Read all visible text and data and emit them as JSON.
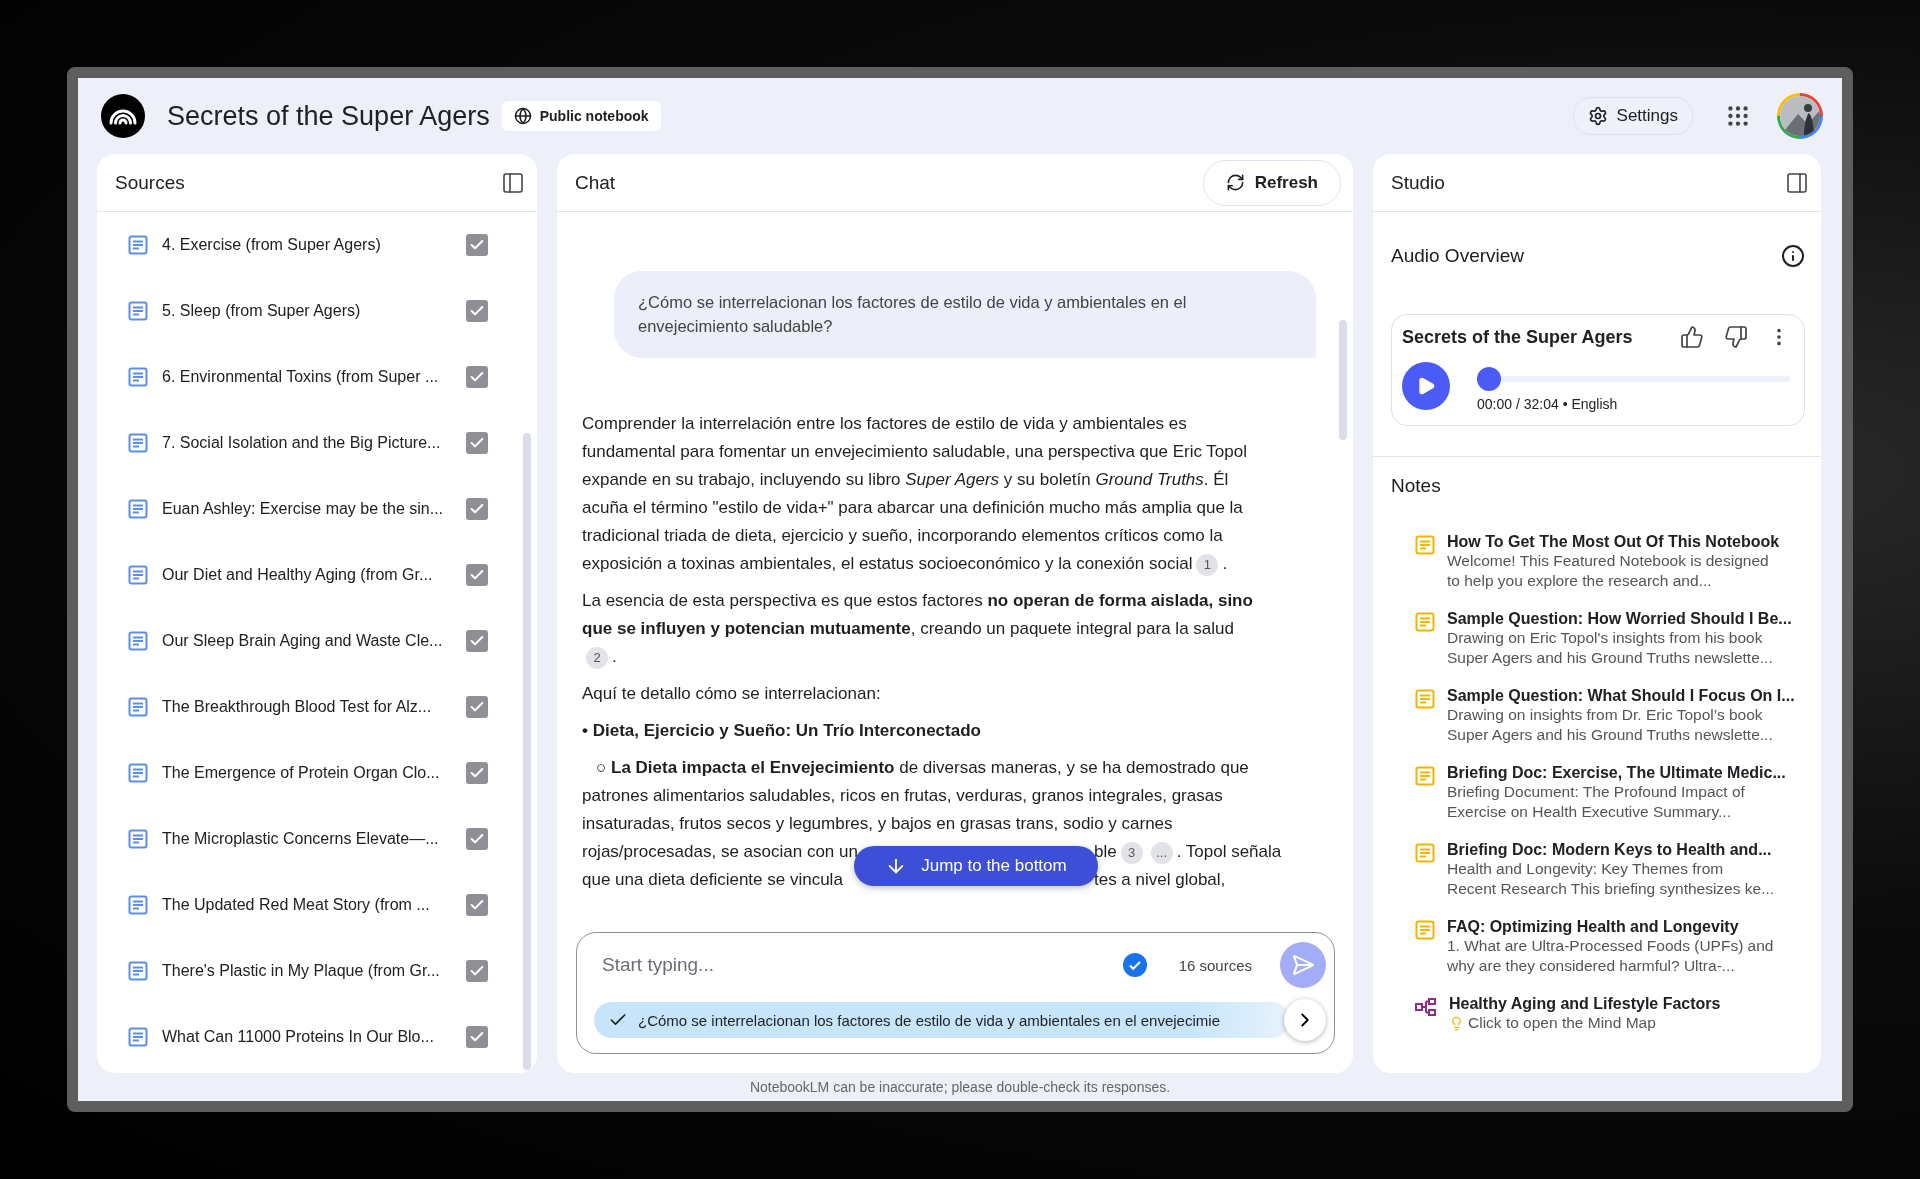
{
  "header": {
    "title": "Secrets of the Super Agers",
    "badge": "Public notebook",
    "settings": "Settings"
  },
  "sources": {
    "title": "Sources",
    "items": [
      {
        "label": "4. Exercise (from Super Agers)",
        "checked": true
      },
      {
        "label": "5. Sleep (from Super Agers)",
        "checked": true
      },
      {
        "label": "6. Environmental Toxins (from Super ...",
        "checked": true
      },
      {
        "label": "7. Social Isolation and the Big Picture...",
        "checked": true
      },
      {
        "label": "Euan Ashley: Exercise may be the sin...",
        "checked": true
      },
      {
        "label": "Our Diet and Healthy Aging (from Gr...",
        "checked": true
      },
      {
        "label": "Our Sleep Brain Aging and Waste Cle...",
        "checked": true
      },
      {
        "label": "The Breakthrough Blood Test for Alz...",
        "checked": true
      },
      {
        "label": "The Emergence of Protein Organ Clo...",
        "checked": true
      },
      {
        "label": "The Microplastic Concerns Elevate—...",
        "checked": true
      },
      {
        "label": "The Updated Red Meat Story (from ...",
        "checked": true
      },
      {
        "label": "There's Plastic in My Plaque (from Gr...",
        "checked": true
      },
      {
        "label": "What Can 11000 Proteins In Our Blo...",
        "checked": true
      }
    ]
  },
  "chat": {
    "title": "Chat",
    "refresh": "Refresh",
    "question": "¿Cómo se interrelacionan los factores de estilo de vida y ambientales en el envejecimiento saludable?",
    "answer": [
      {
        "kind": "paragraph",
        "parts": [
          {
            "kind": "text",
            "text": "Comprender la interrelación entre los factores de estilo de vida y ambientales es fundamental para fomentar un envejecimiento saludable, una perspectiva que Eric Topol expande en su trabajo, incluyendo su libro *Super Agers* y su boletín *Ground Truths*. Él acuña el término \"estilo de vida+\" para abarcar una definición mucho más amplia que la tradicional triada de dieta, ejercicio y sueño, incorporando elementos críticos como la exposición a toxinas ambientales, el estatus socioeconómico y la conexión social"
          },
          {
            "kind": "cite",
            "text": "1"
          },
          {
            "kind": "text",
            "text": "."
          }
        ]
      },
      {
        "kind": "paragraph",
        "parts": [
          {
            "kind": "text",
            "text": "La esencia de esta perspectiva es que estos factores **no operan de forma aislada, sino que se influyen y potencian mutuamente**, creando un paquete integral para la salud"
          },
          {
            "kind": "cite",
            "text": "2"
          },
          {
            "kind": "text",
            "text": "."
          }
        ]
      },
      {
        "kind": "paragraph",
        "parts": [
          {
            "kind": "text",
            "text": "Aquí te detallo cómo se interrelacionan:"
          }
        ]
      },
      {
        "kind": "heading",
        "parts": [
          {
            "kind": "text",
            "text": "• Dieta, Ejercicio y Sueño: Un Trío Interconectado"
          }
        ]
      },
      {
        "kind": "subitem",
        "parts": [
          {
            "kind": "text",
            "text": "○ **La Dieta impacta el Envejecimiento** de diversas maneras, y se ha demostrado que patrones alimentarios saludables, ricos en frutas, verduras, granos integrales, grasas insaturadas, frutos secos y legumbres, y bajos en grasas trans, sodio y carnes"
          }
        ]
      },
      {
        "kind": "covered",
        "overlay": "Jump to the bottom",
        "lines": [
          {
            "left": "rojas/procesadas, se asocian con un",
            "right": [
              {
                "kind": "text",
                "text": "ble"
              },
              {
                "kind": "cite",
                "text": "3"
              },
              {
                "kind": "cite",
                "text": "..."
              },
              {
                "kind": "text",
                "text": ". Topol señala"
              }
            ]
          },
          {
            "left": "que una dieta deficiente se vincula",
            "right": [
              {
                "kind": "text",
                "text": "tes a nivel global,"
              }
            ]
          }
        ]
      }
    ],
    "input": {
      "placeholder": "Start typing...",
      "sources": "16 sources",
      "send_disabled": true,
      "suggestion": "¿Cómo se interrelacionan los factores de estilo de vida y ambientales en el envejecimie"
    }
  },
  "studio": {
    "title": "Studio",
    "audio": {
      "heading": "Audio Overview",
      "title": "Secrets of the Super Agers",
      "level": 0,
      "time": "00:00 / 32:04 • English"
    },
    "notes_title": "Notes",
    "notes": [
      {
        "kind": "note",
        "title": "How To Get The Most Out Of This Notebook",
        "snippet": "Welcome! This Featured Notebook is designed\nto help you explore the research and..."
      },
      {
        "kind": "note",
        "title": "Sample Question: How Worried Should I Be...",
        "snippet": "Drawing on Eric Topol's insights from his book\nSuper Agers and his Ground Truths newslette..."
      },
      {
        "kind": "note",
        "title": "Sample Question: What Should I Focus On I...",
        "snippet": "Drawing on insights from Dr. Eric Topol’s book\nSuper Agers and his Ground Truths newslette..."
      },
      {
        "kind": "note",
        "title": "Briefing Doc: Exercise, The Ultimate Medic...",
        "snippet": "Briefing Document: The Profound Impact of\nExercise on Health Executive Summary..."
      },
      {
        "kind": "note",
        "title": "Briefing Doc: Modern Keys to Health and...",
        "snippet": "Health and Longevity: Key Themes from\nRecent Research This briefing synthesizes ke..."
      },
      {
        "kind": "note",
        "title": "FAQ: Optimizing Health and Longevity",
        "snippet": "1. What are Ultra-Processed Foods (UPFs) and\nwhy are they considered harmful? Ultra-..."
      },
      {
        "kind": "mindmap",
        "title": "Healthy Aging and Lifestyle Factors",
        "snippet": "Click to open the Mind Map"
      }
    ]
  },
  "footer": "NotebookLM can be inaccurate; please double-check its responses."
}
